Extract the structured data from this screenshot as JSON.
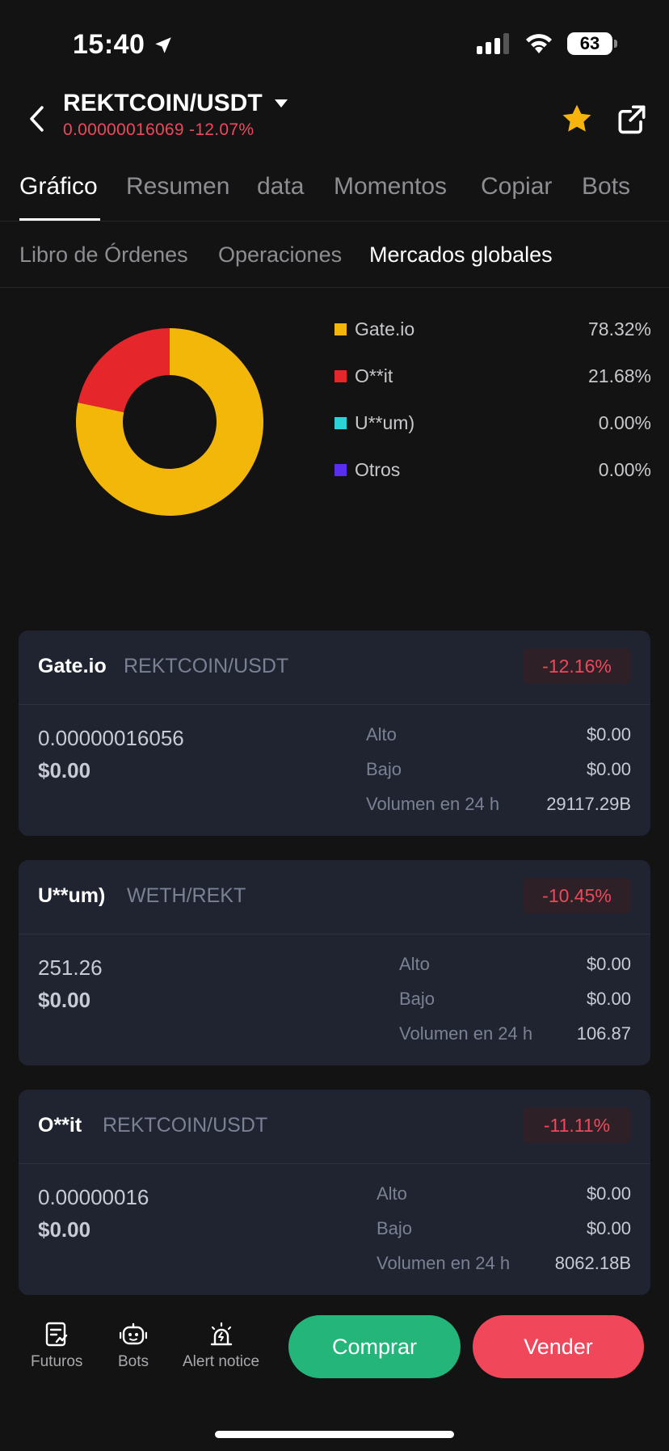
{
  "status_bar": {
    "time": "15:40",
    "battery": "63"
  },
  "header": {
    "pair": "REKTCOIN/USDT",
    "price": "0.00000016069",
    "change": "-12.07%"
  },
  "tabs": [
    {
      "label": "Gráfico"
    },
    {
      "label": "Resumen"
    },
    {
      "label": "data"
    },
    {
      "label": "Momentos"
    },
    {
      "label": "Copiar"
    },
    {
      "label": "Bots"
    }
  ],
  "subtabs": [
    {
      "label": "Libro de Órdenes"
    },
    {
      "label": "Operaciones"
    },
    {
      "label": "Mercados globales"
    }
  ],
  "chart_data": {
    "type": "pie",
    "categories": [
      "Gate.io",
      "O**it",
      "U**um)",
      "Otros"
    ],
    "values": [
      78.32,
      21.68,
      0.0,
      0.0
    ],
    "labels": [
      "78.32%",
      "21.68%",
      "0.00%",
      "0.00%"
    ],
    "colors": [
      "#f3b70a",
      "#e5262b",
      "#2bd3d6",
      "#5a2ef0"
    ],
    "donut": true
  },
  "markets": [
    {
      "exchange": "Gate.io",
      "pair": "REKTCOIN/USDT",
      "change": "-12.16%",
      "price": "0.00000016056",
      "usd": "$0.00",
      "high_label": "Alto",
      "high": "$0.00",
      "low_label": "Bajo",
      "low": "$0.00",
      "volume_label": "Volumen en 24 h",
      "volume": "29117.29B"
    },
    {
      "exchange": "U**um)",
      "pair": "WETH/REKT",
      "change": "-10.45%",
      "price": "251.26",
      "usd": "$0.00",
      "high_label": "Alto",
      "high": "$0.00",
      "low_label": "Bajo",
      "low": "$0.00",
      "volume_label": "Volumen en 24 h",
      "volume": "106.87"
    },
    {
      "exchange": "O**it",
      "pair": "REKTCOIN/USDT",
      "change": "-11.11%",
      "price": "0.00000016",
      "usd": "$0.00",
      "high_label": "Alto",
      "high": "$0.00",
      "low_label": "Bajo",
      "low": "$0.00",
      "volume_label": "Volumen en 24 h",
      "volume": "8062.18B"
    }
  ],
  "bottom_nav": {
    "items": [
      {
        "label": "Futuros",
        "icon": "futures-icon"
      },
      {
        "label": "Bots",
        "icon": "robot-icon"
      },
      {
        "label": "Alert notice",
        "icon": "alarm-icon"
      }
    ],
    "buy_label": "Comprar",
    "sell_label": "Vender"
  }
}
